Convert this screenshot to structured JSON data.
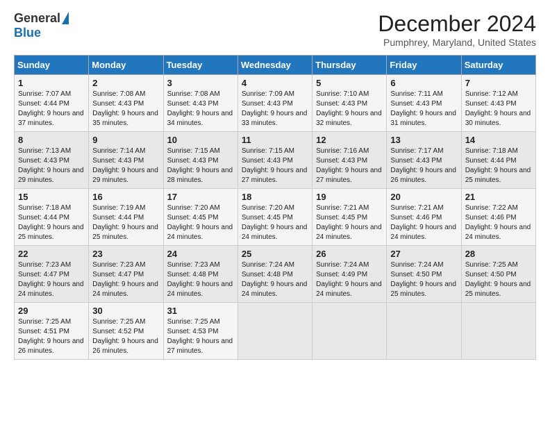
{
  "header": {
    "logo_general": "General",
    "logo_blue": "Blue",
    "month_title": "December 2024",
    "location": "Pumphrey, Maryland, United States"
  },
  "weekdays": [
    "Sunday",
    "Monday",
    "Tuesday",
    "Wednesday",
    "Thursday",
    "Friday",
    "Saturday"
  ],
  "weeks": [
    [
      {
        "day": "1",
        "sunrise": "Sunrise: 7:07 AM",
        "sunset": "Sunset: 4:44 PM",
        "daylight": "Daylight: 9 hours and 37 minutes."
      },
      {
        "day": "2",
        "sunrise": "Sunrise: 7:08 AM",
        "sunset": "Sunset: 4:43 PM",
        "daylight": "Daylight: 9 hours and 35 minutes."
      },
      {
        "day": "3",
        "sunrise": "Sunrise: 7:08 AM",
        "sunset": "Sunset: 4:43 PM",
        "daylight": "Daylight: 9 hours and 34 minutes."
      },
      {
        "day": "4",
        "sunrise": "Sunrise: 7:09 AM",
        "sunset": "Sunset: 4:43 PM",
        "daylight": "Daylight: 9 hours and 33 minutes."
      },
      {
        "day": "5",
        "sunrise": "Sunrise: 7:10 AM",
        "sunset": "Sunset: 4:43 PM",
        "daylight": "Daylight: 9 hours and 32 minutes."
      },
      {
        "day": "6",
        "sunrise": "Sunrise: 7:11 AM",
        "sunset": "Sunset: 4:43 PM",
        "daylight": "Daylight: 9 hours and 31 minutes."
      },
      {
        "day": "7",
        "sunrise": "Sunrise: 7:12 AM",
        "sunset": "Sunset: 4:43 PM",
        "daylight": "Daylight: 9 hours and 30 minutes."
      }
    ],
    [
      {
        "day": "8",
        "sunrise": "Sunrise: 7:13 AM",
        "sunset": "Sunset: 4:43 PM",
        "daylight": "Daylight: 9 hours and 29 minutes."
      },
      {
        "day": "9",
        "sunrise": "Sunrise: 7:14 AM",
        "sunset": "Sunset: 4:43 PM",
        "daylight": "Daylight: 9 hours and 29 minutes."
      },
      {
        "day": "10",
        "sunrise": "Sunrise: 7:15 AM",
        "sunset": "Sunset: 4:43 PM",
        "daylight": "Daylight: 9 hours and 28 minutes."
      },
      {
        "day": "11",
        "sunrise": "Sunrise: 7:15 AM",
        "sunset": "Sunset: 4:43 PM",
        "daylight": "Daylight: 9 hours and 27 minutes."
      },
      {
        "day": "12",
        "sunrise": "Sunrise: 7:16 AM",
        "sunset": "Sunset: 4:43 PM",
        "daylight": "Daylight: 9 hours and 27 minutes."
      },
      {
        "day": "13",
        "sunrise": "Sunrise: 7:17 AM",
        "sunset": "Sunset: 4:43 PM",
        "daylight": "Daylight: 9 hours and 26 minutes."
      },
      {
        "day": "14",
        "sunrise": "Sunrise: 7:18 AM",
        "sunset": "Sunset: 4:44 PM",
        "daylight": "Daylight: 9 hours and 25 minutes."
      }
    ],
    [
      {
        "day": "15",
        "sunrise": "Sunrise: 7:18 AM",
        "sunset": "Sunset: 4:44 PM",
        "daylight": "Daylight: 9 hours and 25 minutes."
      },
      {
        "day": "16",
        "sunrise": "Sunrise: 7:19 AM",
        "sunset": "Sunset: 4:44 PM",
        "daylight": "Daylight: 9 hours and 25 minutes."
      },
      {
        "day": "17",
        "sunrise": "Sunrise: 7:20 AM",
        "sunset": "Sunset: 4:45 PM",
        "daylight": "Daylight: 9 hours and 24 minutes."
      },
      {
        "day": "18",
        "sunrise": "Sunrise: 7:20 AM",
        "sunset": "Sunset: 4:45 PM",
        "daylight": "Daylight: 9 hours and 24 minutes."
      },
      {
        "day": "19",
        "sunrise": "Sunrise: 7:21 AM",
        "sunset": "Sunset: 4:45 PM",
        "daylight": "Daylight: 9 hours and 24 minutes."
      },
      {
        "day": "20",
        "sunrise": "Sunrise: 7:21 AM",
        "sunset": "Sunset: 4:46 PM",
        "daylight": "Daylight: 9 hours and 24 minutes."
      },
      {
        "day": "21",
        "sunrise": "Sunrise: 7:22 AM",
        "sunset": "Sunset: 4:46 PM",
        "daylight": "Daylight: 9 hours and 24 minutes."
      }
    ],
    [
      {
        "day": "22",
        "sunrise": "Sunrise: 7:23 AM",
        "sunset": "Sunset: 4:47 PM",
        "daylight": "Daylight: 9 hours and 24 minutes."
      },
      {
        "day": "23",
        "sunrise": "Sunrise: 7:23 AM",
        "sunset": "Sunset: 4:47 PM",
        "daylight": "Daylight: 9 hours and 24 minutes."
      },
      {
        "day": "24",
        "sunrise": "Sunrise: 7:23 AM",
        "sunset": "Sunset: 4:48 PM",
        "daylight": "Daylight: 9 hours and 24 minutes."
      },
      {
        "day": "25",
        "sunrise": "Sunrise: 7:24 AM",
        "sunset": "Sunset: 4:48 PM",
        "daylight": "Daylight: 9 hours and 24 minutes."
      },
      {
        "day": "26",
        "sunrise": "Sunrise: 7:24 AM",
        "sunset": "Sunset: 4:49 PM",
        "daylight": "Daylight: 9 hours and 24 minutes."
      },
      {
        "day": "27",
        "sunrise": "Sunrise: 7:24 AM",
        "sunset": "Sunset: 4:50 PM",
        "daylight": "Daylight: 9 hours and 25 minutes."
      },
      {
        "day": "28",
        "sunrise": "Sunrise: 7:25 AM",
        "sunset": "Sunset: 4:50 PM",
        "daylight": "Daylight: 9 hours and 25 minutes."
      }
    ],
    [
      {
        "day": "29",
        "sunrise": "Sunrise: 7:25 AM",
        "sunset": "Sunset: 4:51 PM",
        "daylight": "Daylight: 9 hours and 26 minutes."
      },
      {
        "day": "30",
        "sunrise": "Sunrise: 7:25 AM",
        "sunset": "Sunset: 4:52 PM",
        "daylight": "Daylight: 9 hours and 26 minutes."
      },
      {
        "day": "31",
        "sunrise": "Sunrise: 7:25 AM",
        "sunset": "Sunset: 4:53 PM",
        "daylight": "Daylight: 9 hours and 27 minutes."
      },
      null,
      null,
      null,
      null
    ]
  ]
}
